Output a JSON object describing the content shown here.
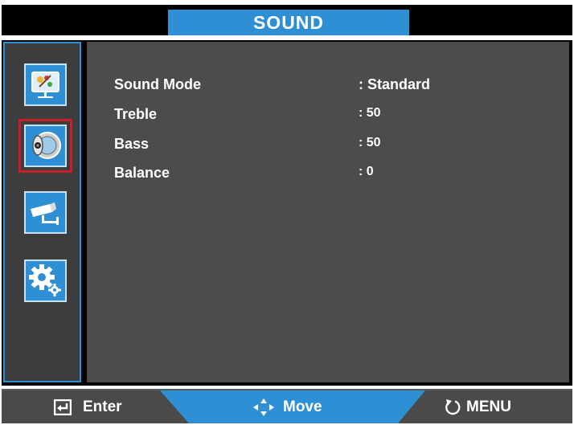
{
  "title": "SOUND",
  "colors": {
    "accent": "#2e8fd4",
    "selection": "#c81e2a",
    "panel": "#4c4c4c",
    "sidebar": "#3d3d3d"
  },
  "sidebar": {
    "items": [
      {
        "name": "picture",
        "icon": "picture-monitor-icon",
        "selected": false
      },
      {
        "name": "sound",
        "icon": "speaker-icon",
        "selected": true
      },
      {
        "name": "camera",
        "icon": "camera-icon",
        "selected": false
      },
      {
        "name": "setup",
        "icon": "gear-icon",
        "selected": false
      }
    ]
  },
  "settings": [
    {
      "label": "Sound Mode",
      "value": ": Standard"
    },
    {
      "label": "Treble",
      "value": ": 50"
    },
    {
      "label": "Bass",
      "value": ": 50"
    },
    {
      "label": "Balance",
      "value": ": 0"
    }
  ],
  "footer": {
    "enter_label": "Enter",
    "enter_icon": "enter-icon",
    "move_label": "Move",
    "move_icon": "move-arrows-icon",
    "menu_label": "MENU",
    "menu_icon": "return-icon"
  }
}
